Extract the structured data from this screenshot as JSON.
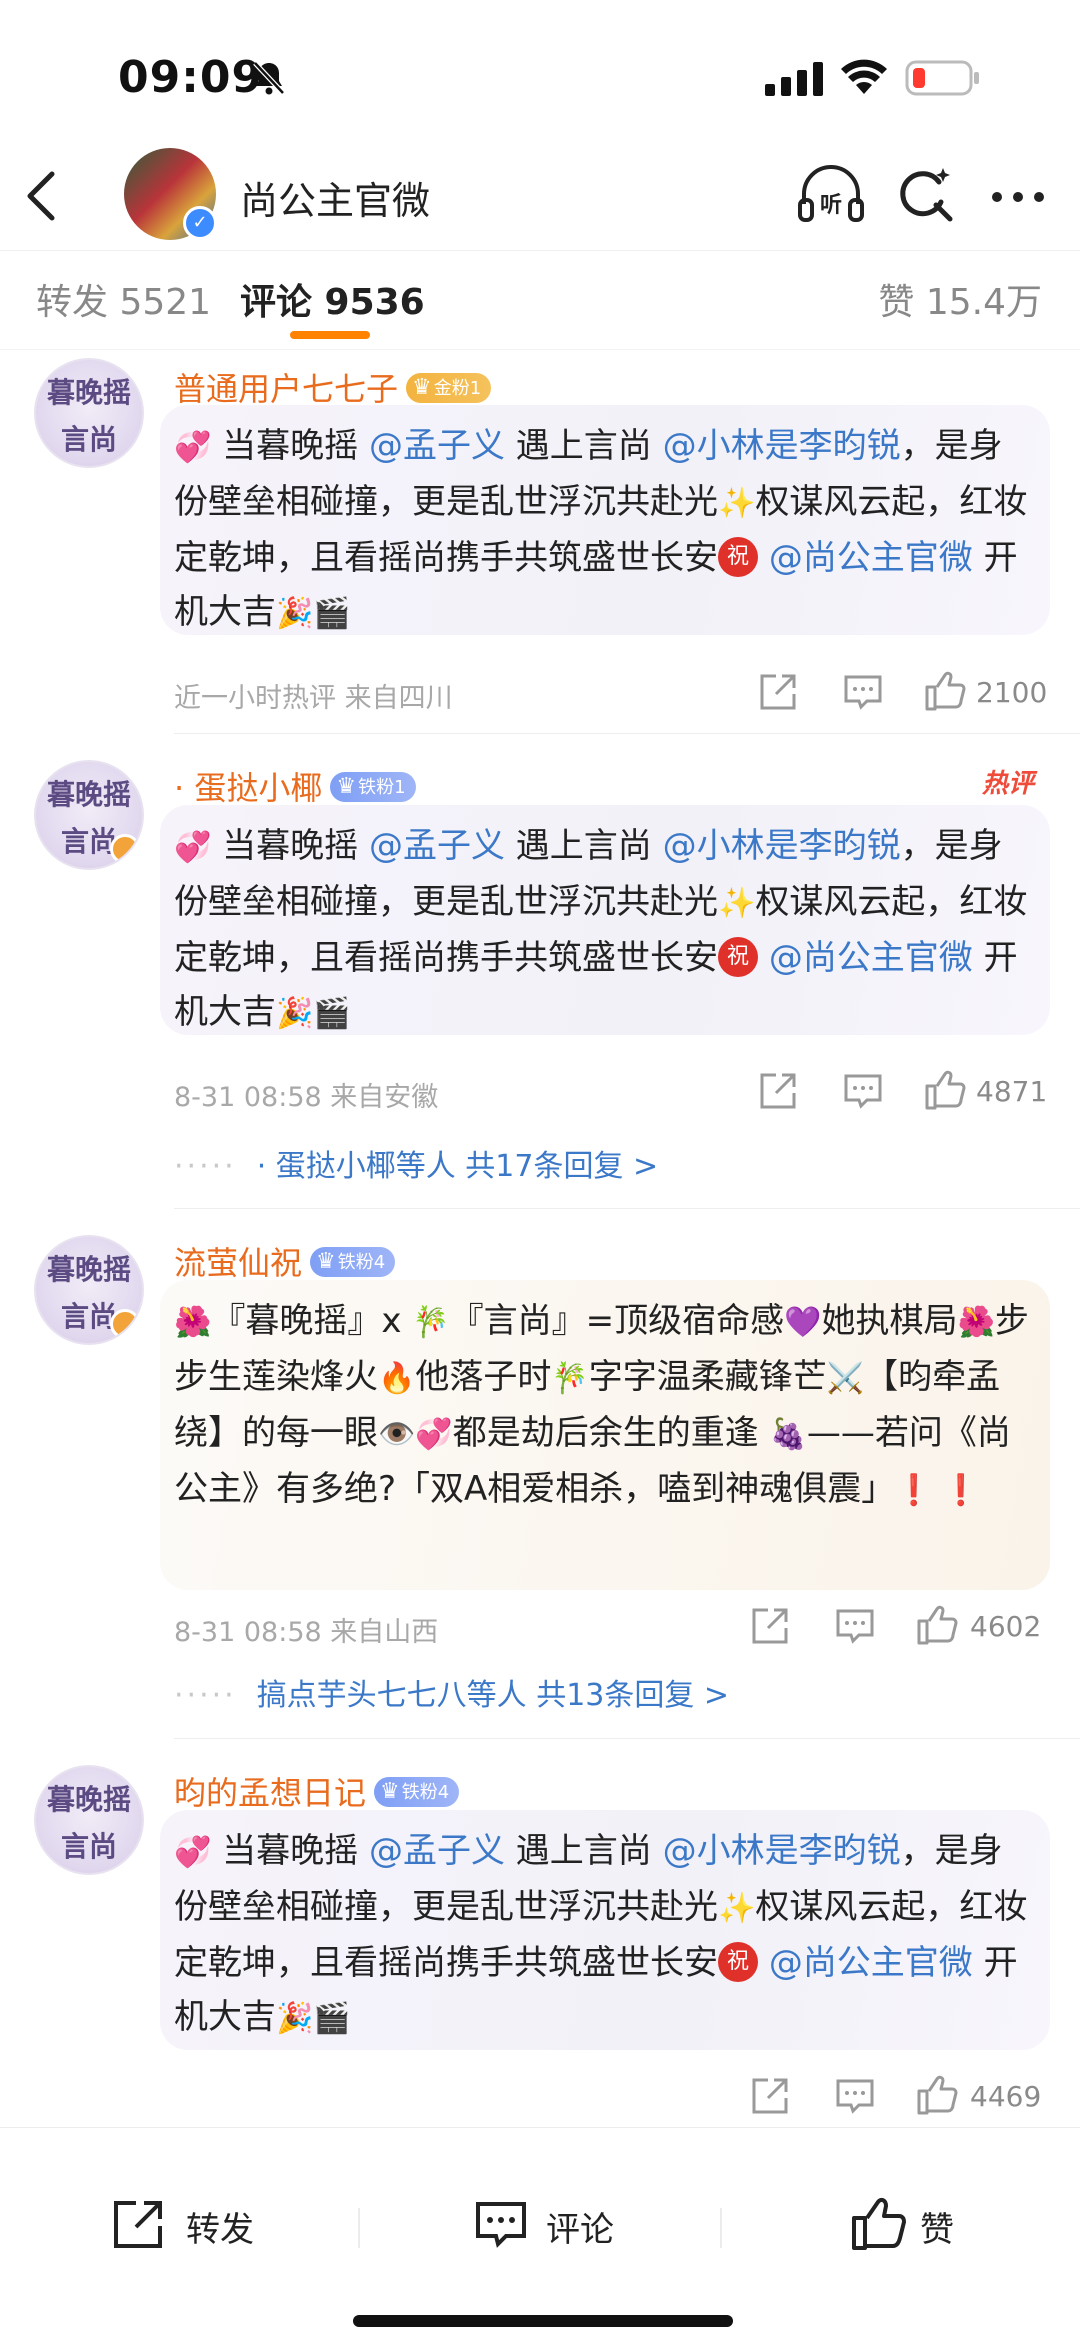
{
  "status": {
    "time": "09:09"
  },
  "header": {
    "title": "尚公主官微"
  },
  "tabs": {
    "repost": "转发 5521",
    "comment": "评论 9536",
    "like": "赞 15.4万"
  },
  "avatar_text": {
    "line1": "暮晚摇",
    "line2": "言尚"
  },
  "comments": [
    {
      "name": "普通用户七七子",
      "badge": "金粉1",
      "segments": [
        "💞",
        " 当暮晚摇 ",
        "@孟子义",
        " 遇上言尚 ",
        "@小林是李昀锐",
        "，是身份壁垒相碰撞，更是乱世浮沉共赴光",
        "✨",
        "权谋风云起，红妆定乾坤，且看摇尚携手共筑盛世长安",
        "祝",
        " ",
        "@尚公主官微",
        " 开机大吉",
        "🎉🎬"
      ],
      "meta": "近一小时热评  来自四川",
      "likes": "2100"
    },
    {
      "name": "· 蛋挞小椰",
      "badge": "铁粉1",
      "hot": "热评",
      "segments": [
        "💞",
        " 当暮晚摇 ",
        "@孟子义",
        " 遇上言尚 ",
        "@小林是李昀锐",
        "，是身份壁垒相碰撞，更是乱世浮沉共赴光",
        "✨",
        "权谋风云起，红妆定乾坤，且看摇尚携手共筑盛世长安",
        "祝",
        " ",
        "@尚公主官微",
        " 开机大吉",
        "🎉🎬"
      ],
      "meta": "8-31 08:58  来自安徽",
      "likes": "4871",
      "replies": "· 蛋挞小椰等人  共17条回复 >"
    },
    {
      "name": "流萤仙祝",
      "badge": "铁粉4",
      "segments": [
        "🌺",
        "『暮晚摇』x ",
        "🎋",
        "『言尚』=顶级宿命感",
        "💜",
        "她执棋局",
        "🌺",
        "步步生莲染烽火",
        "🔥",
        "他落子时",
        "🎋",
        "字字温柔藏锋芒",
        "⚔️",
        "【昀牵孟绕】的每一眼",
        "👁️💞",
        "都是劫后余生的重逢 ",
        "🍇",
        "——若问《尚公主》有多绝?「双A相爱相杀，嗑到神魂俱震」",
        "❗ ❗"
      ],
      "meta": "8-31 08:58  来自山西",
      "likes": "4602",
      "replies": "搞点芋头七七八等人  共13条回复 >"
    },
    {
      "name": "昀的孟想日记",
      "badge": "铁粉4",
      "segments": [
        "💞",
        " 当暮晚摇 ",
        "@孟子义",
        " 遇上言尚 ",
        "@小林是李昀锐",
        "，是身份壁垒相碰撞，更是乱世浮沉共赴光",
        "✨",
        "权谋风云起，红妆定乾坤，且看摇尚携手共筑盛世长安",
        "祝",
        " ",
        "@尚公主官微",
        " 开机大吉",
        "🎉🎬"
      ],
      "likes": "4469"
    }
  ],
  "bottom": {
    "repost": "转发",
    "comment": "评论",
    "like": "赞"
  },
  "colors": {
    "accent": "#ff8200",
    "link": "#3b78c8",
    "username": "#e86b1e"
  }
}
